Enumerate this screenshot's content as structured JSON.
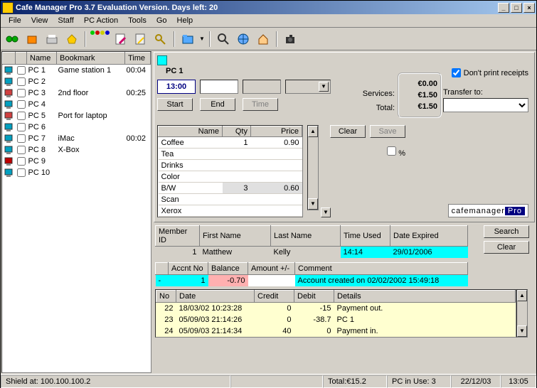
{
  "title": "Cafe Manager Pro 3.7    Evaluation Version. Days left: 20",
  "menu": [
    "File",
    "View",
    "Staff",
    "PC Action",
    "Tools",
    "Go",
    "Help"
  ],
  "pc_list": {
    "headers": [
      "",
      "",
      "Name",
      "Bookmark",
      "Time"
    ],
    "rows": [
      {
        "name": "PC 1",
        "bookmark": "Game station 1",
        "time": "00:04",
        "color": "#00a0c0"
      },
      {
        "name": "PC 2",
        "bookmark": "",
        "time": "",
        "color": "#00a0c0"
      },
      {
        "name": "PC 3",
        "bookmark": "2nd floor",
        "time": "00:25",
        "color": "#d04040"
      },
      {
        "name": "PC 4",
        "bookmark": "",
        "time": "",
        "color": "#00a0c0"
      },
      {
        "name": "PC 5",
        "bookmark": "Port for laptop",
        "time": "",
        "color": "#d04040"
      },
      {
        "name": "PC 6",
        "bookmark": "",
        "time": "",
        "color": "#00a0c0"
      },
      {
        "name": "PC 7",
        "bookmark": "iMac",
        "time": "00:02",
        "color": "#00a0c0"
      },
      {
        "name": "PC 8",
        "bookmark": "X-Box",
        "time": "",
        "color": "#00a0c0"
      },
      {
        "name": "PC 9",
        "bookmark": "",
        "time": "",
        "color": "#c00000"
      },
      {
        "name": "PC 10",
        "bookmark": "",
        "time": "",
        "color": "#00a0c0"
      }
    ]
  },
  "session": {
    "pc_title": "PC 1",
    "time": "13:00",
    "start_label": "Start",
    "end_label": "End",
    "time_btn_label": "Time",
    "services_label": "Services:",
    "total_label": "Total:",
    "totals": {
      "line1": "€0.00",
      "line2": "€1.50",
      "line3": "€1.50"
    },
    "dont_print": "Don't print receipts",
    "transfer_label": "Transfer to:",
    "clear_label": "Clear",
    "save_label": "Save",
    "pct_label": "%"
  },
  "services": {
    "headers": [
      "Name",
      "Qty",
      "Price"
    ],
    "rows": [
      {
        "name": "Coffee",
        "qty": "1",
        "price": "0.90"
      },
      {
        "name": "Tea",
        "qty": "",
        "price": ""
      },
      {
        "name": "Drinks",
        "qty": "",
        "price": ""
      },
      {
        "name": "Color",
        "qty": "",
        "price": ""
      },
      {
        "name": "B/W",
        "qty": "3",
        "price": "0.60"
      },
      {
        "name": "Scan",
        "qty": "",
        "price": ""
      },
      {
        "name": "Xerox",
        "qty": "",
        "price": ""
      }
    ]
  },
  "logo": {
    "text": "cafemanager",
    "pro": "Pro"
  },
  "member": {
    "headers": [
      "Member ID",
      "First Name",
      "Last Name",
      "Time Used",
      "Date Expired"
    ],
    "row": {
      "id": "1",
      "first": "Matthew",
      "last": "Kelly",
      "time_used": "14:14",
      "expired": "29/01/2006"
    },
    "search_label": "Search",
    "clear_label": "Clear"
  },
  "account": {
    "headers": [
      "Accnt No",
      "Balance",
      "Amount +/-",
      "Comment"
    ],
    "row": {
      "no": "1",
      "balance": "-0.70",
      "amount": "",
      "comment": "Account created on 02/02/2002 15:49:18"
    }
  },
  "transactions": {
    "headers": [
      "No",
      "Date",
      "Credit",
      "Debit",
      "Details"
    ],
    "rows": [
      {
        "no": "22",
        "date": "18/03/02 10:23:28",
        "credit": "0",
        "debit": "-15",
        "details": "Payment out."
      },
      {
        "no": "23",
        "date": "05/09/03 21:14:26",
        "credit": "0",
        "debit": "-38.7",
        "details": "PC 1"
      },
      {
        "no": "24",
        "date": "05/09/03 21:14:34",
        "credit": "40",
        "debit": "0",
        "details": "Payment in."
      }
    ]
  },
  "status": {
    "shield": "Shield at: 100.100.100.2",
    "total": "Total:€15.2",
    "pc_in_use": "PC in Use: 3",
    "date": "22/12/03",
    "time": "13:05"
  }
}
